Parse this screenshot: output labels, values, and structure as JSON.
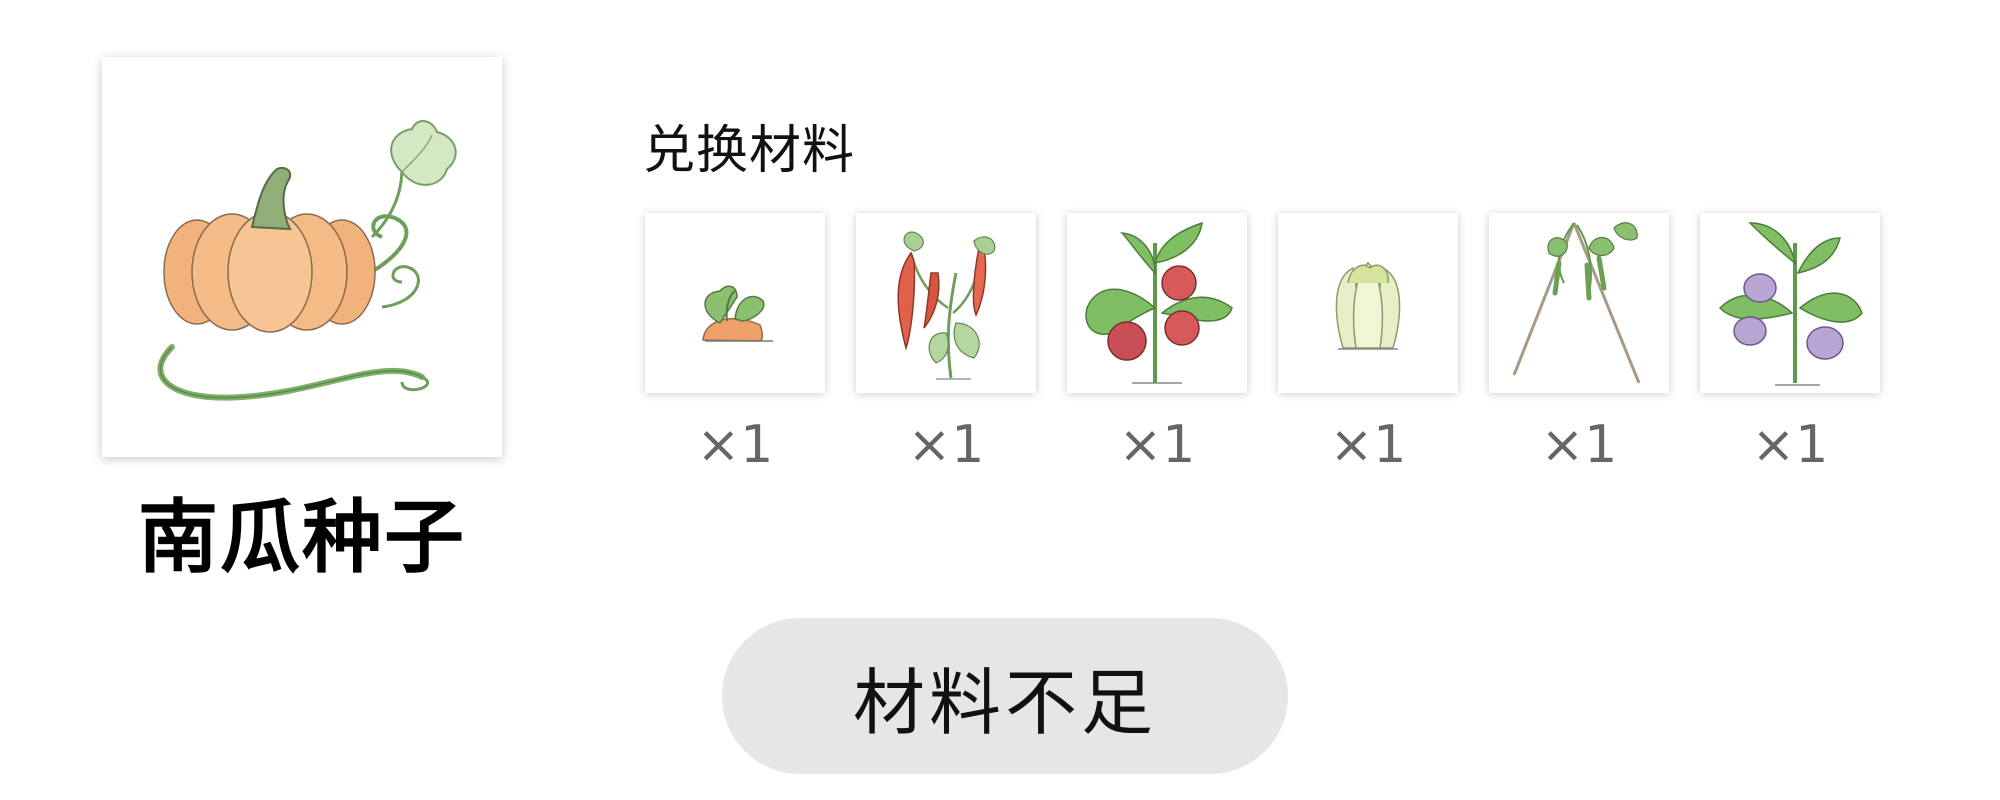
{
  "item": {
    "name": "南瓜种子",
    "image_icon": "pumpkin-icon"
  },
  "materials": {
    "label": "兑换材料",
    "items": [
      {
        "icon": "carrot-icon",
        "qty": "×1"
      },
      {
        "icon": "chili-pepper-icon",
        "qty": "×1"
      },
      {
        "icon": "tomato-plant-icon",
        "qty": "×1"
      },
      {
        "icon": "cabbage-icon",
        "qty": "×1"
      },
      {
        "icon": "bean-trellis-icon",
        "qty": "×1"
      },
      {
        "icon": "eggplant-plant-icon",
        "qty": "×1"
      }
    ]
  },
  "action": {
    "label": "材料不足"
  },
  "colors": {
    "button_bg": "#e6e6e6",
    "qty_text": "#666666"
  }
}
